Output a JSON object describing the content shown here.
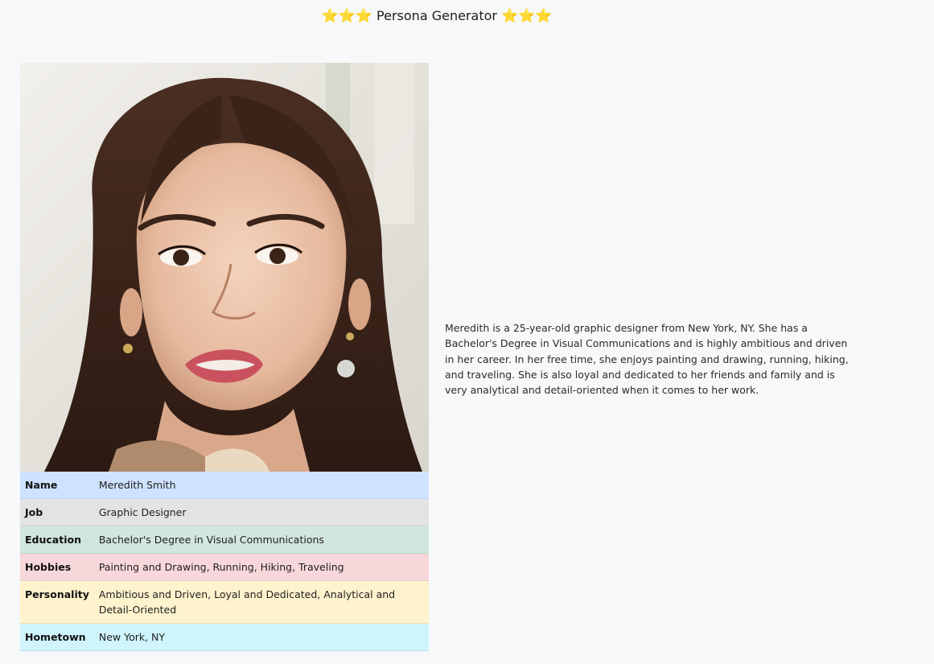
{
  "header": {
    "star_left": "⭐⭐⭐",
    "title": "Persona Generator",
    "star_right": "⭐⭐⭐"
  },
  "persona": {
    "photo_alt": "Persona portrait",
    "rows": [
      {
        "key": "Name",
        "value": "Meredith Smith"
      },
      {
        "key": "Job",
        "value": "Graphic Designer"
      },
      {
        "key": "Education",
        "value": "Bachelor's Degree in Visual Communications"
      },
      {
        "key": "Hobbies",
        "value": "Painting and Drawing, Running, Hiking, Traveling"
      },
      {
        "key": "Personality",
        "value": "Ambitious and Driven, Loyal and Dedicated, Analytical and Detail-Oriented"
      },
      {
        "key": "Hometown",
        "value": "New York, NY"
      }
    ],
    "bio": "Meredith is a 25-year-old graphic designer from New York, NY. She has a Bachelor's Degree in Visual Communications and is highly ambitious and driven in her career. In her free time, she enjoys painting and drawing, running, hiking, and traveling. She is also loyal and dedicated to her friends and family and is very analytical and detail-oriented when it comes to her work."
  },
  "colors": {
    "background": "#f7f8fa",
    "row_name": "#cfe2ff",
    "row_job": "#e2e3e5",
    "row_education": "#d1e7dd",
    "row_hobbies": "#f8d7da",
    "row_personality": "#fff3cd",
    "row_hometown": "#cff4fc"
  }
}
